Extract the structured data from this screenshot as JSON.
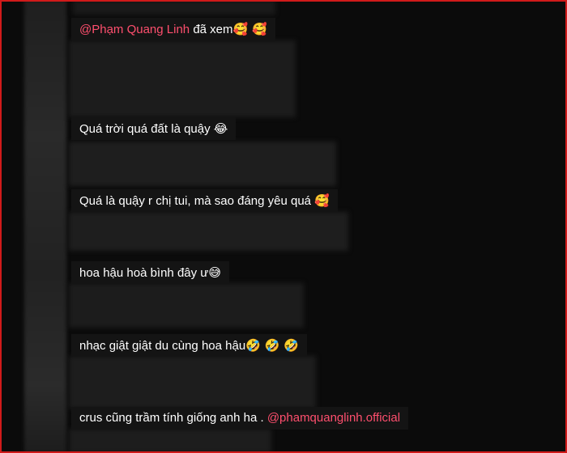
{
  "comments": [
    {
      "mention": "@Phạm Quang Linh",
      "text": " đã xem",
      "emoji": "🥰 🥰"
    },
    {
      "text": "Quá trời quá đất là quậy ",
      "emoji": "😂"
    },
    {
      "text": "Quá là quậy r chị tui, mà sao đáng yêu quá ",
      "emoji": "🥰"
    },
    {
      "text": "hoa hậu hoà bình đây ư",
      "emoji": "😅"
    },
    {
      "text": "nhạc giật giật du cùng hoa hậu",
      "emoji": "🤣 🤣 🤣"
    },
    {
      "text": "crus cũng trầm tính giống anh ha . ",
      "mention": "@phamquanglinh.official"
    }
  ]
}
